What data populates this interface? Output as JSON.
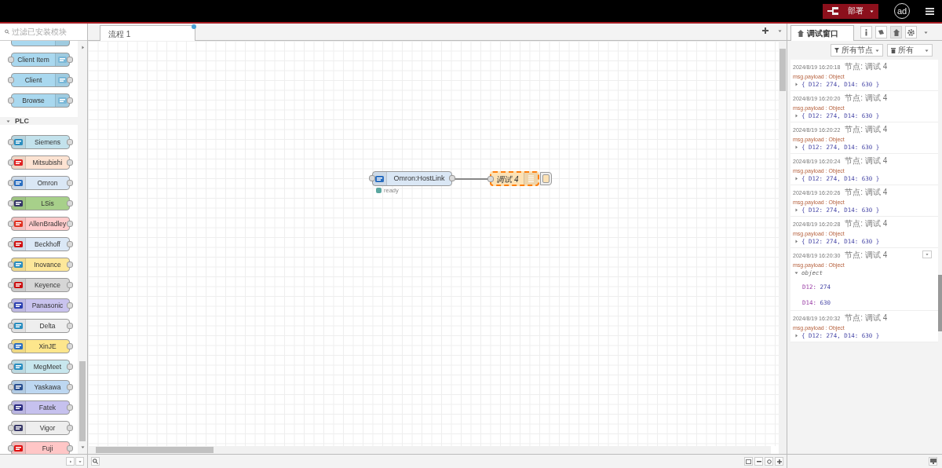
{
  "header": {
    "deploy_label": "部署",
    "user_initials": "ad"
  },
  "palette": {
    "search_placeholder": "过滤已安装模块",
    "top_nodes": [
      {
        "label": "Client Item",
        "color": "#a9d8ef"
      },
      {
        "label": "Client",
        "color": "#a9d8ef"
      },
      {
        "label": "Browse",
        "color": "#a9d8ef"
      }
    ],
    "category": {
      "name": "PLC",
      "expanded": true,
      "nodes": [
        {
          "label": "Siemens",
          "color": "#c3e2ec"
        },
        {
          "label": "Mitsubishi",
          "color": "#fde3d2"
        },
        {
          "label": "Omron",
          "color": "#dae7f5"
        },
        {
          "label": "LSis",
          "color": "#a7d08a"
        },
        {
          "label": "AllenBradley",
          "color": "#ffcccc"
        },
        {
          "label": "Beckhoff",
          "color": "#dbe8f6"
        },
        {
          "label": "Inovance",
          "color": "#fde79a"
        },
        {
          "label": "Keyence",
          "color": "#d6d6d6"
        },
        {
          "label": "Panasonic",
          "color": "#c9c3ee"
        },
        {
          "label": "Delta",
          "color": "#eeeeee"
        },
        {
          "label": "XinJE",
          "color": "#fde68c"
        },
        {
          "label": "MegMeet",
          "color": "#c8e7ee"
        },
        {
          "label": "Yaskawa",
          "color": "#bdd7f1"
        },
        {
          "label": "Fatek",
          "color": "#c6c1ee"
        },
        {
          "label": "Vigor",
          "color": "#eeeeee"
        },
        {
          "label": "Fuji",
          "color": "#ffc6c6"
        }
      ]
    }
  },
  "workspace": {
    "tabs": [
      {
        "label": "流程 1",
        "selected": true,
        "changed": true
      }
    ],
    "nodes": [
      {
        "kind": "plc",
        "label": "Omron:HostLink",
        "status": "ready",
        "selected": false
      },
      {
        "kind": "debug",
        "label": "调试 4",
        "selected": true,
        "active": true
      }
    ]
  },
  "sidebar": {
    "tabs": [
      {
        "label": "调试窗口",
        "selected": true
      }
    ],
    "panels": [
      {
        "kind": "info",
        "selected": false
      },
      {
        "kind": "help",
        "selected": false
      },
      {
        "kind": "debug",
        "selected": true
      },
      {
        "kind": "config",
        "selected": false
      }
    ],
    "filter": {
      "nodes_label": "所有节点",
      "clear_label": "所有"
    },
    "messages": [
      {
        "time": "2024/8/19 16:20:18",
        "node": "节点: 调试 4",
        "topic": "msg.payload : Object",
        "expanded": false,
        "preview": "{ D12: 274, D14: 630 }"
      },
      {
        "time": "2024/8/19 16:20:20",
        "node": "节点: 调试 4",
        "topic": "msg.payload : Object",
        "expanded": false,
        "preview": "{ D12: 274, D14: 630 }"
      },
      {
        "time": "2024/8/19 16:20:22",
        "node": "节点: 调试 4",
        "topic": "msg.payload : Object",
        "expanded": false,
        "preview": "{ D12: 274, D14: 630 }"
      },
      {
        "time": "2024/8/19 16:20:24",
        "node": "节点: 调试 4",
        "topic": "msg.payload : Object",
        "expanded": false,
        "preview": "{ D12: 274, D14: 630 }"
      },
      {
        "time": "2024/8/19 16:20:26",
        "node": "节点: 调试 4",
        "topic": "msg.payload : Object",
        "expanded": false,
        "preview": "{ D12: 274, D14: 630 }"
      },
      {
        "time": "2024/8/19 16:20:28",
        "node": "节点: 调试 4",
        "topic": "msg.payload : Object",
        "expanded": false,
        "preview": "{ D12: 274, D14: 630 }"
      },
      {
        "time": "2024/8/19 16:20:30",
        "node": "节点: 调试 4",
        "topic": "msg.payload : Object",
        "expanded": true,
        "type": "object",
        "props": [
          {
            "key": "D12:",
            "value": "274"
          },
          {
            "key": "D14:",
            "value": "630"
          }
        ]
      },
      {
        "time": "2024/8/19 16:20:32",
        "node": "节点: 调试 4",
        "topic": "msg.payload : Object",
        "expanded": false,
        "preview": "{ D12: 274, D14: 630 }"
      }
    ]
  }
}
